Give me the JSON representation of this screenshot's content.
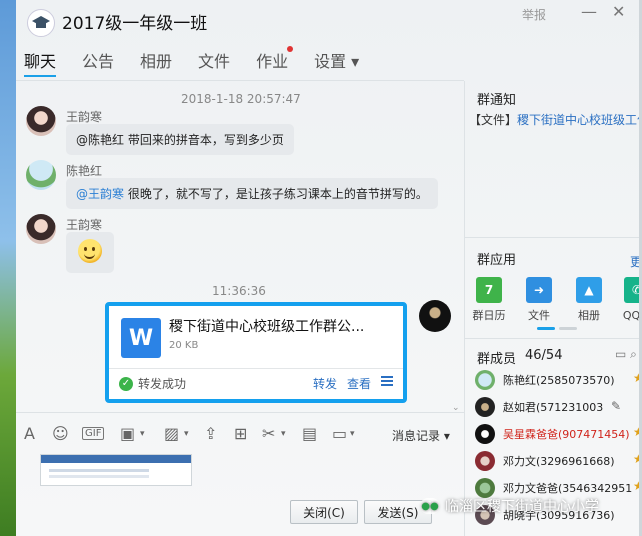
{
  "window": {
    "title": "2017级一年级一班",
    "report_label": "举报",
    "minimize_glyph": "—",
    "close_glyph": "✕"
  },
  "tabs": [
    {
      "label": "聊天",
      "active": true
    },
    {
      "label": "公告"
    },
    {
      "label": "相册"
    },
    {
      "label": "文件"
    },
    {
      "label": "作业",
      "has_dot": true
    },
    {
      "label": "设置 ▾"
    }
  ],
  "chat": {
    "timestamp1": "2018-1-18 20:57:47",
    "messages": [
      {
        "sender": "王韵寒",
        "mention": "@陈艳红",
        "text": " 带回来的拼音本，写到多少页"
      },
      {
        "sender": "陈艳红",
        "mention": "@王韵寒",
        "text": " 很晚了，就不写了，是让孩子练习课本上的音节拼写的。"
      },
      {
        "sender": "王韵寒",
        "emoji": "smile-emoji"
      }
    ],
    "timestamp2": "11:36:36",
    "file": {
      "icon_letter": "W",
      "name": "稷下街道中心校班级工作群公...",
      "size": "20 KB",
      "status": "转发成功",
      "forward_label": "转发",
      "view_label": "查看"
    }
  },
  "toolbar": {
    "gif_label": "GIF",
    "history_label": "消息记录 ▾"
  },
  "buttons": {
    "close_label": "关闭(C)",
    "send_label": "发送(S)"
  },
  "right_panel": {
    "notice_title": "群通知",
    "notice_tag": "【文件】",
    "notice_text": "稷下街道中心校班级工作",
    "apps_title": "群应用",
    "more_label": "更",
    "apps": [
      {
        "label": "群日历",
        "icon": "calendar-icon",
        "color": "#3fb34a",
        "glyph": "7"
      },
      {
        "label": "文件",
        "icon": "file-icon",
        "color": "#2f8fe0",
        "glyph": "➜"
      },
      {
        "label": "相册",
        "icon": "photo-icon",
        "color": "#2f9ee8",
        "glyph": "▲"
      },
      {
        "label": "QQ电",
        "icon": "phone-icon",
        "color": "#16b38a",
        "glyph": "✆"
      }
    ],
    "members_title": "群成员",
    "members_count": "46/54",
    "members": [
      {
        "name": "陈艳红(2585073570)",
        "red": false
      },
      {
        "name": "赵如君(571231003",
        "red": false
      },
      {
        "name": "吴星霖爸爸(907471454)",
        "red": true
      },
      {
        "name": "邓力文(3296961668)",
        "red": false
      },
      {
        "name": "邓力文爸爸(3546342951",
        "red": false
      },
      {
        "name": "胡晓宇(3095916736)",
        "red": false
      }
    ]
  },
  "watermark": {
    "text": "临淄区稷下街道中心小学",
    "icon_glyph": "●●"
  }
}
